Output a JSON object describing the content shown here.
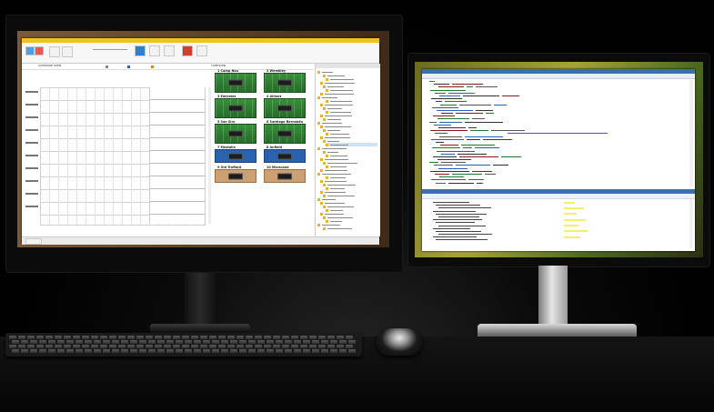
{
  "left_monitor": {
    "app_window": {
      "panel_title": "Schedule view",
      "fields_header": "Overview",
      "fields": [
        {
          "label": "1 Camp Nou",
          "surface": "grass"
        },
        {
          "label": "2 Wembley",
          "surface": "grass"
        },
        {
          "label": "3 Emirates",
          "surface": "grass"
        },
        {
          "label": "4 Allianz",
          "surface": "grass"
        },
        {
          "label": "5 San Siro",
          "surface": "grass"
        },
        {
          "label": "6 Santiago Bernabéu",
          "surface": "grass"
        },
        {
          "label": "7 Mestalla",
          "surface": "indoor"
        },
        {
          "label": "8 Anfield",
          "surface": "indoor"
        },
        {
          "label": "9 Old Trafford",
          "surface": "clay"
        },
        {
          "label": "10 Maracanã",
          "surface": "clay"
        }
      ],
      "colors": {
        "ribbon": "#f3c21b",
        "grass": "#2e7d32",
        "indoor": "#2a62b0",
        "clay": "#cda073"
      }
    }
  },
  "right_monitor": {
    "ide_window": {
      "colors": {
        "titlebar": "#3c6eb4",
        "code_bg": "#ffffff",
        "highlight": "#f5f06a"
      }
    }
  },
  "desk_items": [
    "keyboard",
    "mouse"
  ]
}
